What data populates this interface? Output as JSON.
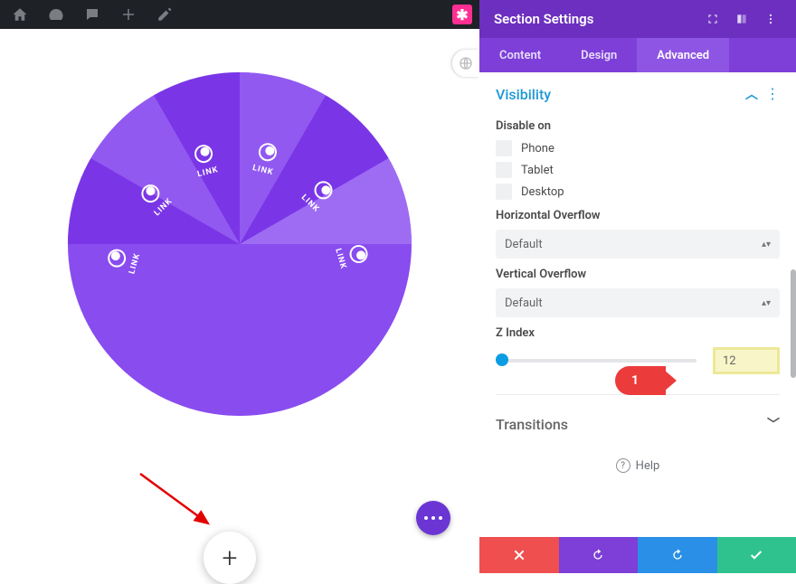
{
  "topbar": {
    "icons": [
      "home-icon",
      "gauge-icon",
      "comment-icon",
      "plus-icon",
      "pencil-icon"
    ],
    "badge_glyph": "✱"
  },
  "pie": {
    "slices": [
      {
        "label": "LINK",
        "icon": "pie-icon"
      },
      {
        "label": "LINK",
        "icon": "pie-icon"
      },
      {
        "label": "LINK",
        "icon": "pie-icon"
      },
      {
        "label": "LINK",
        "icon": "pie-icon"
      },
      {
        "label": "LINK",
        "icon": "pie-icon"
      },
      {
        "label": "LINK",
        "icon": "pie-icon"
      }
    ]
  },
  "callouts": {
    "step1": "1"
  },
  "panel": {
    "title": "Section Settings",
    "tabs": {
      "content": "Content",
      "design": "Design",
      "advanced": "Advanced",
      "active": "advanced"
    },
    "groups": {
      "visibility": {
        "title": "Visibility",
        "disable_on_label": "Disable on",
        "options": {
          "phone": "Phone",
          "tablet": "Tablet",
          "desktop": "Desktop"
        },
        "h_overflow_label": "Horizontal Overflow",
        "h_overflow_value": "Default",
        "v_overflow_label": "Vertical Overflow",
        "v_overflow_value": "Default",
        "zindex_label": "Z Index",
        "zindex_value": "12"
      },
      "transitions": {
        "title": "Transitions"
      }
    },
    "help_label": "Help"
  }
}
